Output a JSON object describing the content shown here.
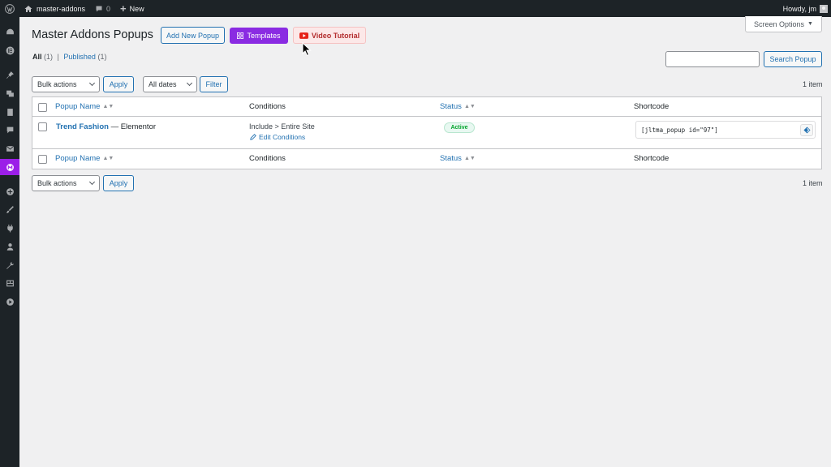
{
  "admin_bar": {
    "wp_logo_icon": "wordpress-icon",
    "site_name": "master-addons",
    "comments_count": "0",
    "new_label": "New",
    "howdy": "Howdy, jm"
  },
  "side_menu": {
    "icons": [
      "dashboard-icon",
      "elementor-icon",
      "pin-icon",
      "media-icon",
      "pages-icon",
      "comments-icon",
      "mail-icon",
      "master-addons-icon",
      "plus-circle-icon",
      "brush-icon",
      "plugins-icon",
      "users-icon",
      "tools-icon",
      "settings-icon",
      "play-icon"
    ],
    "accent": "#9b1ee8"
  },
  "page": {
    "title": "Master Addons Popups",
    "add_new_label": "Add New Popup",
    "templates_label": "Templates",
    "video_label": "Video Tutorial",
    "screen_options_label": "Screen Options",
    "filter_all": "All",
    "filter_all_count": "(1)",
    "filter_sep": "|",
    "filter_published": "Published",
    "filter_published_count": "(1)",
    "search_placeholder": "",
    "search_button": "Search Popup",
    "bulk_actions_label": "Bulk actions",
    "apply_label": "Apply",
    "dates_label": "All dates",
    "filter_label": "Filter",
    "items_count": "1 item"
  },
  "table": {
    "columns": {
      "name": "Popup Name",
      "conditions": "Conditions",
      "status": "Status",
      "shortcode": "Shortcode"
    },
    "rows": [
      {
        "name": "Trend Fashion",
        "suffix": "— Elementor",
        "conditions": "Include > Entire Site",
        "edit_conditions": "Edit Conditions",
        "status": "Active",
        "shortcode": "[jltma_popup id=\"97\"]"
      }
    ]
  },
  "colors": {
    "templates_button": "#8a2be2",
    "video_button_text": "#b32d2e",
    "link": "#2271b1",
    "active_status": "#00a32a"
  }
}
